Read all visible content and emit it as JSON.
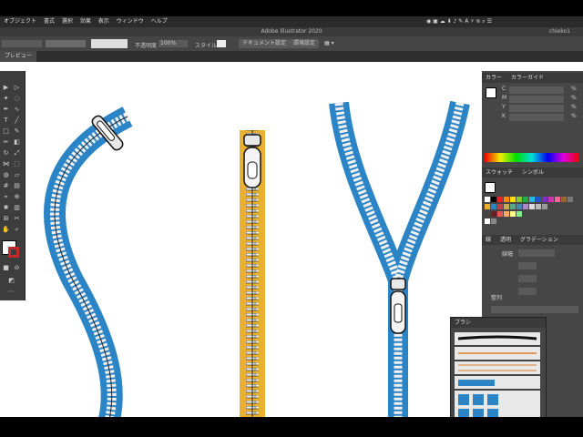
{
  "app": {
    "menu": [
      "オブジェクト",
      "書式",
      "選択",
      "効果",
      "表示",
      "ウィンドウ",
      "ヘルプ"
    ],
    "user": "chieko1",
    "window_title": "Adobe Illustrator 2020"
  },
  "control_bar": {
    "opacity_label": "不透明度",
    "opacity_value": "100%",
    "style_label": "スタイル",
    "doc_setup_button": "ドキュメント設定",
    "prefs_button": "環境設定"
  },
  "document_tab": "プレビュー",
  "color_panel": {
    "tab_color": "カラー",
    "tab_guide": "カラーガイド",
    "channels": [
      "C",
      "M",
      "Y",
      "K"
    ],
    "unit": "%"
  },
  "swatches_panel": {
    "tab_swatches": "スウォッチ",
    "tab_symbols": "シンボル"
  },
  "stroke_panel": {
    "tab_stroke": "線",
    "tab_transparency": "透明",
    "tab_gradient": "グラデーション",
    "weight_label": "線幅"
  },
  "brush_panel": {
    "title": "ブラシ"
  },
  "align_label": "整列",
  "colors": {
    "zipper_blue": "#2b84c6",
    "zipper_yellow": "#eab030",
    "panel_bg": "#464646"
  }
}
